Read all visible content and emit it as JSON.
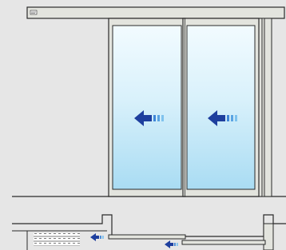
{
  "diagram": {
    "kind": "sliding-door-elevation-and-plan",
    "colors": {
      "background": "#e6e6e6",
      "frame_fill": "#e3e4de",
      "frame_stroke": "#2a2a2a",
      "glass_light": "#f2fbff",
      "glass_blue": "#a9dcf3",
      "arrow_dark": "#1e3f9e",
      "arrow_mid": "#3f86d8",
      "arrow_light": "#7fc2ee",
      "wall_hatch": "#5a5a5a"
    },
    "icons": {
      "header_label": "operator-label-icon",
      "open_direction": "left-arrow-icon",
      "motion_lines": "motion-lines-icon",
      "wall_hatch": "hatch-pattern"
    },
    "elevation": {
      "panel_count": 2,
      "panel_arrow_direction": "left"
    },
    "plan": {
      "arrow_direction": "left",
      "arrow_count": 2
    }
  }
}
